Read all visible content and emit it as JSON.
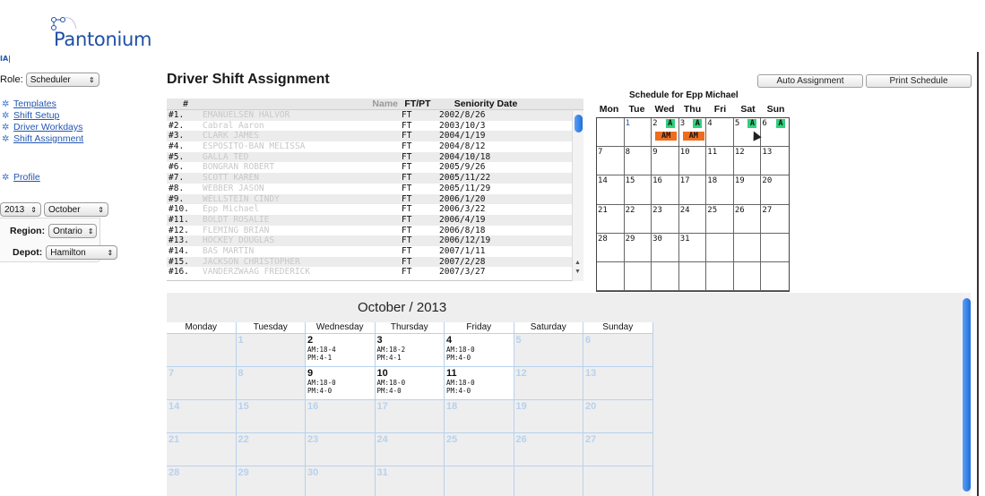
{
  "app": {
    "logo_text": "Pantonium",
    "corner_mark": "IA|"
  },
  "sidebar": {
    "role_label": "Role:",
    "role_value": "Scheduler",
    "nav": [
      {
        "label": "Templates"
      },
      {
        "label": "Shift Setup"
      },
      {
        "label": "Driver Workdays"
      },
      {
        "label": "Shift Assignment"
      }
    ],
    "profile": "Profile",
    "year": "2013",
    "month": "October",
    "region_label": "Region:",
    "region_value": "Ontario",
    "depot_label": "Depot:",
    "depot_value": "Hamilton"
  },
  "header": {
    "title": "Driver Shift Assignment",
    "auto_button": "Auto Assignment",
    "print_button": "Print Schedule"
  },
  "driver_table": {
    "columns": [
      "#",
      "Name",
      "FT/PT",
      "Seniority Date"
    ],
    "rows": [
      {
        "num": "#1.",
        "name": "EMANUELSEN HALVOR",
        "type": "FT",
        "date": "2002/8/26"
      },
      {
        "num": "#2.",
        "name": "Cabral Aaron",
        "type": "FT",
        "date": "2003/10/3"
      },
      {
        "num": "#3.",
        "name": "CLARK JAMES",
        "type": "FT",
        "date": "2004/1/19"
      },
      {
        "num": "#4.",
        "name": "ESPOSITO-BAN MELISSA",
        "type": "FT",
        "date": "2004/8/12"
      },
      {
        "num": "#5.",
        "name": "GALLA TED",
        "type": "FT",
        "date": "2004/10/18"
      },
      {
        "num": "#6.",
        "name": "BONGRAN ROBERT",
        "type": "FT",
        "date": "2005/9/26"
      },
      {
        "num": "#7.",
        "name": "SCOTT KAREN",
        "type": "FT",
        "date": "2005/11/22"
      },
      {
        "num": "#8.",
        "name": "WEBBER JASON",
        "type": "FT",
        "date": "2005/11/29"
      },
      {
        "num": "#9.",
        "name": "WELLSTEIN CINDY",
        "type": "FT",
        "date": "2006/1/20"
      },
      {
        "num": "#10.",
        "name": "Epp Michael",
        "type": "FT",
        "date": "2006/3/22"
      },
      {
        "num": "#11.",
        "name": "BOLDT ROSALIE",
        "type": "FT",
        "date": "2006/4/19"
      },
      {
        "num": "#12.",
        "name": "FLEMING BRIAN",
        "type": "FT",
        "date": "2006/8/18"
      },
      {
        "num": "#13.",
        "name": "HOCKEY DOUGLAS",
        "type": "FT",
        "date": "2006/12/19"
      },
      {
        "num": "#14.",
        "name": "BAS MARTIN",
        "type": "FT",
        "date": "2007/1/11"
      },
      {
        "num": "#15.",
        "name": "JACKSON CHRISTOPHER",
        "type": "FT",
        "date": "2007/2/28"
      },
      {
        "num": "#16.",
        "name": "VANDERZWAAG FREDERICK",
        "type": "FT",
        "date": "2007/3/27"
      }
    ]
  },
  "schedule": {
    "title": "Schedule for Epp Michael",
    "weekdays": [
      "Mon",
      "Tue",
      "Wed",
      "Thu",
      "Fri",
      "Sat",
      "Sun"
    ],
    "cells": [
      "",
      "1",
      "2",
      "3",
      "4",
      "5",
      "6",
      "7",
      "8",
      "9",
      "10",
      "11",
      "12",
      "13",
      "14",
      "15",
      "16",
      "17",
      "18",
      "19",
      "20",
      "21",
      "22",
      "23",
      "24",
      "25",
      "26",
      "27",
      "28",
      "29",
      "30",
      "31",
      "",
      "",
      "",
      "",
      "",
      "",
      "",
      "",
      "",
      ""
    ],
    "tag_a": "A",
    "tag_am": "AM"
  },
  "month": {
    "title": "October / 2013",
    "weekdays": [
      "Monday",
      "Tuesday",
      "Wednesday",
      "Thursday",
      "Friday",
      "Saturday",
      "Sunday"
    ],
    "weeks": [
      [
        {
          "n": ""
        },
        {
          "n": "1"
        },
        {
          "n": "2",
          "a": "AM:18-4",
          "p": "PM:4-1"
        },
        {
          "n": "3",
          "a": "AM:18-2",
          "p": "PM:4-1"
        },
        {
          "n": "4",
          "a": "AM:18-0",
          "p": "PM:4-0"
        },
        {
          "n": "5"
        },
        {
          "n": "6"
        }
      ],
      [
        {
          "n": "7"
        },
        {
          "n": "8"
        },
        {
          "n": "9",
          "a": "AM:18-0",
          "p": "PM:4-0"
        },
        {
          "n": "10",
          "a": "AM:18-0",
          "p": "PM:4-0"
        },
        {
          "n": "11",
          "a": "AM:18-0",
          "p": "PM:4-0"
        },
        {
          "n": "12"
        },
        {
          "n": "13"
        }
      ],
      [
        {
          "n": "14"
        },
        {
          "n": "15"
        },
        {
          "n": "16"
        },
        {
          "n": "17"
        },
        {
          "n": "18"
        },
        {
          "n": "19"
        },
        {
          "n": "20"
        }
      ],
      [
        {
          "n": "21"
        },
        {
          "n": "22"
        },
        {
          "n": "23"
        },
        {
          "n": "24"
        },
        {
          "n": "25"
        },
        {
          "n": "26"
        },
        {
          "n": "27"
        }
      ],
      [
        {
          "n": "28"
        },
        {
          "n": "29"
        },
        {
          "n": "30"
        },
        {
          "n": "31"
        },
        {
          "n": ""
        },
        {
          "n": ""
        },
        {
          "n": ""
        }
      ]
    ]
  },
  "colors": {
    "accent_blue": "#2356b0",
    "tag_green": "#2fd17b",
    "tag_orange": "#ee6d1f"
  }
}
